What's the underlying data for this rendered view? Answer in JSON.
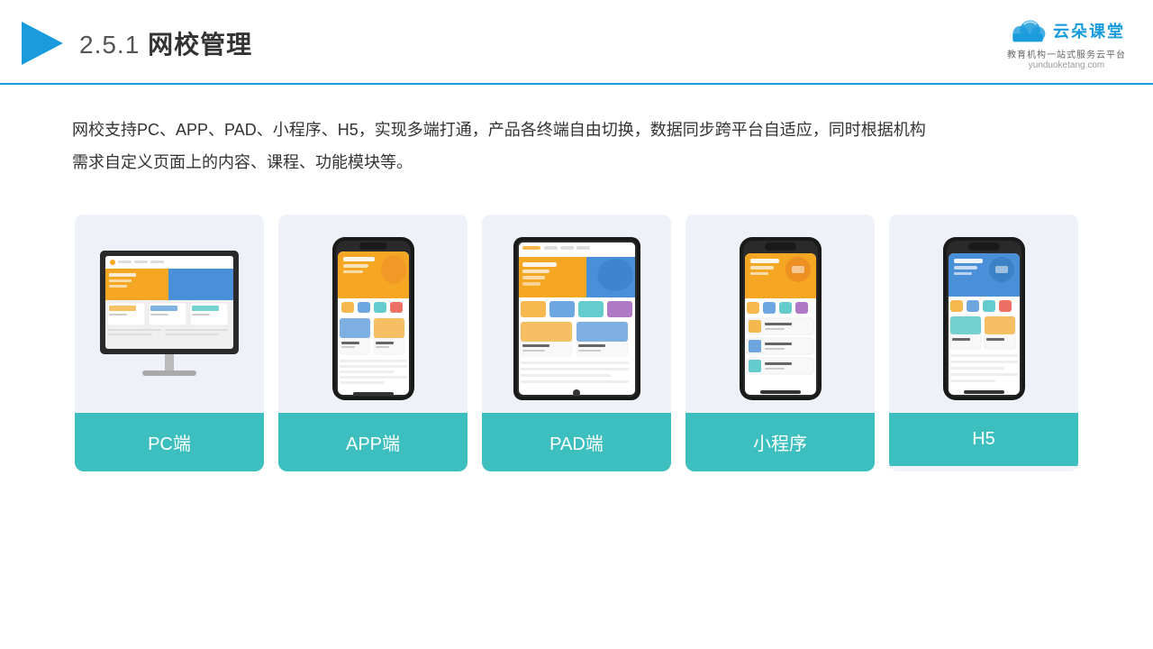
{
  "header": {
    "title": "2.5.1网校管理",
    "title_number": "2.5.1",
    "title_name": "网校管理",
    "logo_name": "云朵课堂",
    "logo_url": "yunduoketang.com",
    "logo_tagline": "教育机构一站式服务云平台"
  },
  "description": {
    "text": "网校支持PC、APP、PAD、小程序、H5，实现多端打通，产品各终端自由切换，数据同步跨平台自适应，同时根据机构需求自定义页面上的内容、课程、功能模块等。"
  },
  "cards": [
    {
      "id": "pc",
      "label": "PC端"
    },
    {
      "id": "app",
      "label": "APP端"
    },
    {
      "id": "pad",
      "label": "PAD端"
    },
    {
      "id": "miniprogram",
      "label": "小程序"
    },
    {
      "id": "h5",
      "label": "H5"
    }
  ],
  "accent_color": "#3dbfbf",
  "header_line_color": "#1a9bdc"
}
